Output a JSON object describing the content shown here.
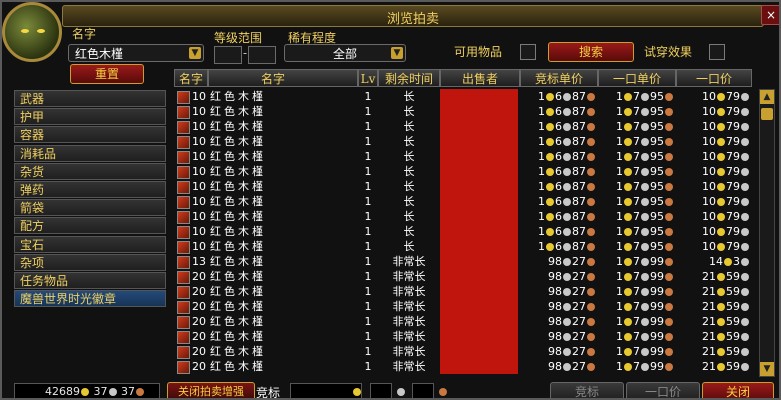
{
  "window": {
    "title": "浏览拍卖",
    "close": "×"
  },
  "search": {
    "name_label": "名字",
    "name_value": "红色木槿",
    "level_label": "等级范围",
    "level_dash": "-",
    "rarity_label": "稀有程度",
    "rarity_value": "全部",
    "usable_label": "可用物品",
    "search_button": "搜索",
    "tryon_label": "试穿效果",
    "reset_button": "重置"
  },
  "categories": [
    "武器",
    "护甲",
    "容器",
    "消耗品",
    "杂货",
    "弹药",
    "箭袋",
    "配方",
    "宝石",
    "杂项",
    "任务物品",
    "魔兽世界时光徽章"
  ],
  "selected_category": 11,
  "columns": {
    "name_num": "名字",
    "name": "名字",
    "lv": "Lv",
    "time": "剩余时间",
    "seller": "出售者",
    "bid": "竞标单价",
    "buyout_unit": "一口单价",
    "buyout": "一口价"
  },
  "rows": [
    {
      "qty": "10",
      "name": "红色木槿",
      "lv": "1",
      "time": "长",
      "bid": [
        "1",
        "6",
        "87"
      ],
      "unit": [
        "1",
        "7",
        "95"
      ],
      "buy": [
        "10",
        "79"
      ]
    },
    {
      "qty": "10",
      "name": "红色木槿",
      "lv": "1",
      "time": "长",
      "bid": [
        "1",
        "6",
        "87"
      ],
      "unit": [
        "1",
        "7",
        "95"
      ],
      "buy": [
        "10",
        "79"
      ]
    },
    {
      "qty": "10",
      "name": "红色木槿",
      "lv": "1",
      "time": "长",
      "bid": [
        "1",
        "6",
        "87"
      ],
      "unit": [
        "1",
        "7",
        "95"
      ],
      "buy": [
        "10",
        "79"
      ]
    },
    {
      "qty": "10",
      "name": "红色木槿",
      "lv": "1",
      "time": "长",
      "bid": [
        "1",
        "6",
        "87"
      ],
      "unit": [
        "1",
        "7",
        "95"
      ],
      "buy": [
        "10",
        "79"
      ]
    },
    {
      "qty": "10",
      "name": "红色木槿",
      "lv": "1",
      "time": "长",
      "bid": [
        "1",
        "6",
        "87"
      ],
      "unit": [
        "1",
        "7",
        "95"
      ],
      "buy": [
        "10",
        "79"
      ]
    },
    {
      "qty": "10",
      "name": "红色木槿",
      "lv": "1",
      "time": "长",
      "bid": [
        "1",
        "6",
        "87"
      ],
      "unit": [
        "1",
        "7",
        "95"
      ],
      "buy": [
        "10",
        "79"
      ]
    },
    {
      "qty": "10",
      "name": "红色木槿",
      "lv": "1",
      "time": "长",
      "bid": [
        "1",
        "6",
        "87"
      ],
      "unit": [
        "1",
        "7",
        "95"
      ],
      "buy": [
        "10",
        "79"
      ]
    },
    {
      "qty": "10",
      "name": "红色木槿",
      "lv": "1",
      "time": "长",
      "bid": [
        "1",
        "6",
        "87"
      ],
      "unit": [
        "1",
        "7",
        "95"
      ],
      "buy": [
        "10",
        "79"
      ]
    },
    {
      "qty": "10",
      "name": "红色木槿",
      "lv": "1",
      "time": "长",
      "bid": [
        "1",
        "6",
        "87"
      ],
      "unit": [
        "1",
        "7",
        "95"
      ],
      "buy": [
        "10",
        "79"
      ]
    },
    {
      "qty": "10",
      "name": "红色木槿",
      "lv": "1",
      "time": "长",
      "bid": [
        "1",
        "6",
        "87"
      ],
      "unit": [
        "1",
        "7",
        "95"
      ],
      "buy": [
        "10",
        "79"
      ]
    },
    {
      "qty": "10",
      "name": "红色木槿",
      "lv": "1",
      "time": "长",
      "bid": [
        "1",
        "6",
        "87"
      ],
      "unit": [
        "1",
        "7",
        "95"
      ],
      "buy": [
        "10",
        "79"
      ]
    },
    {
      "qty": "13",
      "name": "红色木槿",
      "lv": "1",
      "time": "非常长",
      "bid": [
        "98",
        "27"
      ],
      "unit": [
        "1",
        "7",
        "99"
      ],
      "buy": [
        "14",
        "3"
      ]
    },
    {
      "qty": "20",
      "name": "红色木槿",
      "lv": "1",
      "time": "非常长",
      "bid": [
        "98",
        "27"
      ],
      "unit": [
        "1",
        "7",
        "99"
      ],
      "buy": [
        "21",
        "59"
      ]
    },
    {
      "qty": "20",
      "name": "红色木槿",
      "lv": "1",
      "time": "非常长",
      "bid": [
        "98",
        "27"
      ],
      "unit": [
        "1",
        "7",
        "99"
      ],
      "buy": [
        "21",
        "59"
      ]
    },
    {
      "qty": "20",
      "name": "红色木槿",
      "lv": "1",
      "time": "非常长",
      "bid": [
        "98",
        "27"
      ],
      "unit": [
        "1",
        "7",
        "99"
      ],
      "buy": [
        "21",
        "59"
      ]
    },
    {
      "qty": "20",
      "name": "红色木槿",
      "lv": "1",
      "time": "非常长",
      "bid": [
        "98",
        "27"
      ],
      "unit": [
        "1",
        "7",
        "99"
      ],
      "buy": [
        "21",
        "59"
      ]
    },
    {
      "qty": "20",
      "name": "红色木槿",
      "lv": "1",
      "time": "非常长",
      "bid": [
        "98",
        "27"
      ],
      "unit": [
        "1",
        "7",
        "99"
      ],
      "buy": [
        "21",
        "59"
      ]
    },
    {
      "qty": "20",
      "name": "红色木槿",
      "lv": "1",
      "time": "非常长",
      "bid": [
        "98",
        "27"
      ],
      "unit": [
        "1",
        "7",
        "99"
      ],
      "buy": [
        "21",
        "59"
      ]
    },
    {
      "qty": "20",
      "name": "红色木槿",
      "lv": "1",
      "time": "非常长",
      "bid": [
        "98",
        "27"
      ],
      "unit": [
        "1",
        "7",
        "99"
      ],
      "buy": [
        "21",
        "59"
      ]
    }
  ],
  "footer": {
    "money_gold": "42689",
    "money_silver": "37",
    "money_copper": "37",
    "close_enhance": "关闭拍卖增强",
    "bid_label": "竞标",
    "bid_button": "竞标",
    "buyout_button": "一口价",
    "close_button": "关闭"
  },
  "colors": {
    "seller_red": "#c0150d",
    "gold": "#e8c830",
    "accent": "#f0d060"
  }
}
